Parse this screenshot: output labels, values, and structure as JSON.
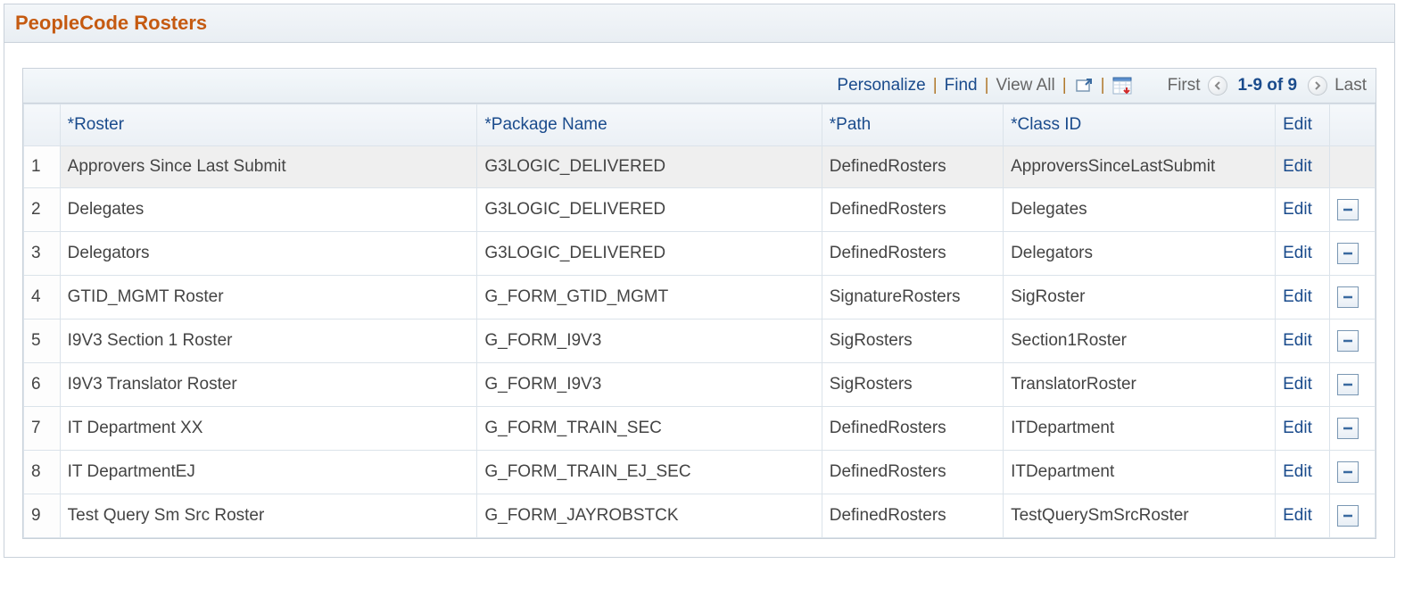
{
  "panel_title": "PeopleCode Rosters",
  "toolbar": {
    "personalize": "Personalize",
    "find": "Find",
    "view_all": "View All",
    "first": "First",
    "last": "Last",
    "range": "1-9 of 9"
  },
  "columns": {
    "roster": "Roster",
    "package": "Package Name",
    "path": "Path",
    "classid": "Class ID",
    "edit": "Edit"
  },
  "edit_label": "Edit",
  "rows": [
    {
      "n": "1",
      "roster": "Approvers Since Last Submit",
      "package": "G3LOGIC_DELIVERED",
      "path": "DefinedRosters",
      "classid": "ApproversSinceLastSubmit",
      "selected": true,
      "deletable": false
    },
    {
      "n": "2",
      "roster": "Delegates",
      "package": "G3LOGIC_DELIVERED",
      "path": "DefinedRosters",
      "classid": "Delegates",
      "selected": false,
      "deletable": true
    },
    {
      "n": "3",
      "roster": "Delegators",
      "package": "G3LOGIC_DELIVERED",
      "path": "DefinedRosters",
      "classid": "Delegators",
      "selected": false,
      "deletable": true
    },
    {
      "n": "4",
      "roster": "GTID_MGMT Roster",
      "package": "G_FORM_GTID_MGMT",
      "path": "SignatureRosters",
      "classid": "SigRoster",
      "selected": false,
      "deletable": true
    },
    {
      "n": "5",
      "roster": "I9V3 Section 1 Roster",
      "package": "G_FORM_I9V3",
      "path": "SigRosters",
      "classid": "Section1Roster",
      "selected": false,
      "deletable": true
    },
    {
      "n": "6",
      "roster": "I9V3 Translator Roster",
      "package": "G_FORM_I9V3",
      "path": "SigRosters",
      "classid": "TranslatorRoster",
      "selected": false,
      "deletable": true
    },
    {
      "n": "7",
      "roster": "IT Department XX",
      "package": "G_FORM_TRAIN_SEC",
      "path": "DefinedRosters",
      "classid": "ITDepartment",
      "selected": false,
      "deletable": true
    },
    {
      "n": "8",
      "roster": "IT DepartmentEJ",
      "package": "G_FORM_TRAIN_EJ_SEC",
      "path": "DefinedRosters",
      "classid": "ITDepartment",
      "selected": false,
      "deletable": true
    },
    {
      "n": "9",
      "roster": "Test Query Sm Src Roster",
      "package": "G_FORM_JAYROBSTCK",
      "path": "DefinedRosters",
      "classid": "TestQuerySmSrcRoster",
      "selected": false,
      "deletable": true
    }
  ]
}
